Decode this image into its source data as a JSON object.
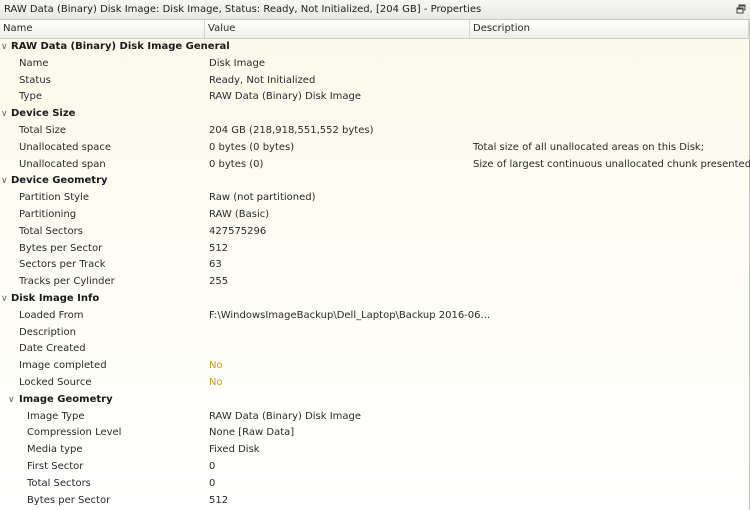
{
  "window": {
    "title": "RAW Data (Binary) Disk Image: Disk Image, Status: Ready, Not Initialized, [204 GB] - Properties",
    "restore_icon": "restore-window-icon"
  },
  "columns": {
    "name": "Name",
    "value": "Value",
    "description": "Description"
  },
  "colors": {
    "warning_value": "#d49a1c",
    "background": "#fdfcf2"
  },
  "groups": {
    "general": {
      "title": "RAW Data (Binary) Disk Image General",
      "rows": [
        {
          "name": "Name",
          "value": "Disk Image",
          "description": ""
        },
        {
          "name": "Status",
          "value": "Ready, Not Initialized",
          "description": ""
        },
        {
          "name": "Type",
          "value": "RAW Data (Binary) Disk Image",
          "description": ""
        }
      ]
    },
    "device_size": {
      "title": "Device Size",
      "rows": [
        {
          "name": "Total Size",
          "value": "204 GB (218,918,551,552 bytes)",
          "description": ""
        },
        {
          "name": "Unallocated space",
          "value": "0 bytes (0 bytes)",
          "description": "Total size of all unallocated areas on this Disk;"
        },
        {
          "name": "Unallocated span",
          "value": "0 bytes (0)",
          "description": "Size of largest continuous unallocated chunk presented ..."
        }
      ]
    },
    "device_geometry": {
      "title": "Device Geometry",
      "rows": [
        {
          "name": "Partition Style",
          "value": "Raw (not partitioned)",
          "description": ""
        },
        {
          "name": "Partitioning",
          "value": "RAW (Basic)",
          "description": ""
        },
        {
          "name": "Total Sectors",
          "value": "427575296",
          "description": ""
        },
        {
          "name": "Bytes per Sector",
          "value": "512",
          "description": ""
        },
        {
          "name": "Sectors per Track",
          "value": "63",
          "description": ""
        },
        {
          "name": "Tracks per Cylinder",
          "value": "255",
          "description": ""
        }
      ]
    },
    "disk_image_info": {
      "title": "Disk Image Info",
      "rows": [
        {
          "name": "Loaded From",
          "value": "F:\\WindowsImageBackup\\Dell_Laptop\\Backup 2016-06...",
          "description": ""
        },
        {
          "name": "Description",
          "value": "",
          "description": ""
        },
        {
          "name": "Date Created",
          "value": "",
          "description": ""
        },
        {
          "name": "Image completed",
          "value": "No",
          "description": ""
        },
        {
          "name": "Locked Source",
          "value": "No",
          "description": ""
        }
      ]
    },
    "image_geometry": {
      "title": "Image Geometry",
      "rows": [
        {
          "name": "Image Type",
          "value": "RAW Data (Binary) Disk Image",
          "description": ""
        },
        {
          "name": "Compression Level",
          "value": "None [Raw Data]",
          "description": ""
        },
        {
          "name": "Media type",
          "value": "Fixed Disk",
          "description": ""
        },
        {
          "name": "First Sector",
          "value": "0",
          "description": ""
        },
        {
          "name": "Total Sectors",
          "value": "0",
          "description": ""
        },
        {
          "name": "Bytes per Sector",
          "value": "512",
          "description": ""
        }
      ]
    }
  }
}
